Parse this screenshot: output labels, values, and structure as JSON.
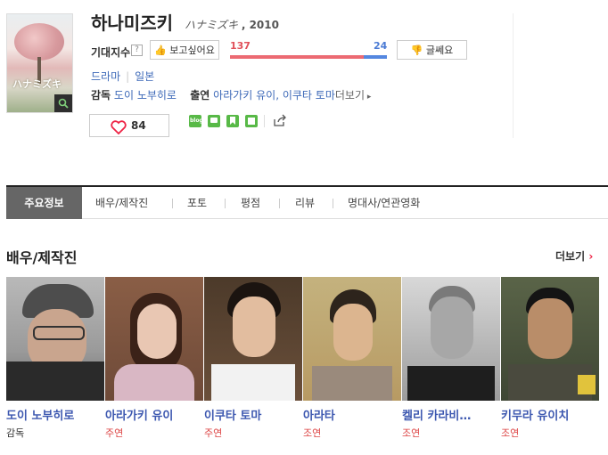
{
  "movie": {
    "title": "하나미즈키",
    "original_title": "ハナミズキ",
    "year": ", 2010",
    "poster_caption": "ハナミズキ"
  },
  "expectation": {
    "label": "기대지수",
    "help": "?",
    "like_label": "보고싶어요",
    "dislike_label": "글쎄요",
    "like_count": "137",
    "dislike_count": "24",
    "like_ratio": 0.851
  },
  "info": {
    "genre": "드라마",
    "country": "일본",
    "director_label": "감독",
    "director": "도이 노부히로",
    "cast_label": "출연",
    "cast": "아라가키 유이, 이쿠타 토마",
    "more": "더보기"
  },
  "social": {
    "like_count": "84",
    "sns": [
      "blog-icon",
      "cafe-icon",
      "bookmark-icon",
      "me2day-icon",
      "share-icon"
    ]
  },
  "tabs": [
    "주요정보",
    "배우/제작진",
    "포토",
    "평점",
    "리뷰",
    "명대사/연관영화"
  ],
  "section": {
    "title": "배우/제작진",
    "more": "더보기"
  },
  "people": [
    {
      "name": "도이 노부히로",
      "role": "감독"
    },
    {
      "name": "아라가키 유이",
      "role": "주연"
    },
    {
      "name": "이쿠타 토마",
      "role": "주연"
    },
    {
      "name": "아라타",
      "role": "조연"
    },
    {
      "name": "켈리 카라비…",
      "role": "조연"
    },
    {
      "name": "키무라 유이치",
      "role": "조연"
    }
  ],
  "colors": {
    "like": "#ec6a72",
    "dislike": "#5487e0",
    "link": "#3d69b8",
    "role": "#dd4444",
    "sns_green": "#58b947"
  }
}
